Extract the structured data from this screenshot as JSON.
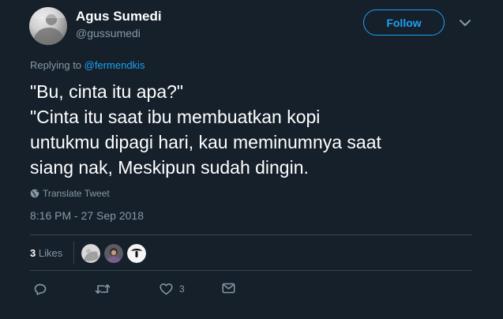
{
  "user": {
    "display_name": "Agus Sumedi",
    "handle": "@gussumedi",
    "avatar_icon": "user-avatar"
  },
  "follow_button": {
    "label": "Follow"
  },
  "more_menu": {
    "icon": "chevron-down-icon"
  },
  "replying_to": {
    "prefix": "Replying to",
    "mention": "@fermendkis"
  },
  "tweet": {
    "lines": [
      "\"Bu, cinta itu apa?\"",
      "\"Cinta itu saat ibu membuatkan kopi",
      "untukmu dipagi hari, kau meminumnya saat",
      "siang nak, Meskipun sudah dingin."
    ],
    "translate_label": "Translate Tweet",
    "timestamp": "8:16 PM - 27 Sep 2018"
  },
  "stats": {
    "likes_count": "3",
    "likes_label": "Likes",
    "likers": [
      "liker-avatar-1",
      "liker-avatar-2",
      "liker-avatar-3"
    ]
  },
  "actions": {
    "reply_icon": "reply-icon",
    "retweet_icon": "retweet-icon",
    "like_icon": "heart-icon",
    "like_count": "3",
    "dm_icon": "envelope-icon"
  },
  "colors": {
    "background": "#15202b",
    "accent": "#1da1f2",
    "muted_text": "#8899a6",
    "divider": "#38444d"
  }
}
